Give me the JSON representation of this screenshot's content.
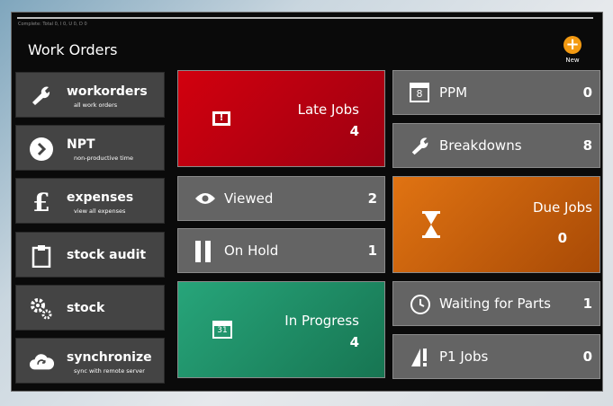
{
  "status_line": "Complete: Total 0, I 0, U 0, D 0",
  "app": {
    "title": "Work Orders",
    "new_label": "New"
  },
  "sidebar": {
    "items": [
      {
        "label": "workorders",
        "sub": "all work orders",
        "icon": "wrench-icon"
      },
      {
        "label": "NPT",
        "sub": "non-productive time",
        "icon": "arrow-right-circle-icon"
      },
      {
        "label": "expenses",
        "sub": "view all expenses",
        "icon": "pound-icon"
      },
      {
        "label": "stock audit",
        "sub": "",
        "icon": "clipboard-icon"
      },
      {
        "label": "stock",
        "sub": "",
        "icon": "gears-icon"
      },
      {
        "label": "synchronize",
        "sub": "sync with remote server",
        "icon": "cloud-sync-icon"
      }
    ]
  },
  "tiles": {
    "late_jobs": {
      "label": "Late Jobs",
      "count": "4",
      "color": "#b3000f"
    },
    "viewed": {
      "label": "Viewed",
      "count": "2"
    },
    "on_hold": {
      "label": "On Hold",
      "count": "1"
    },
    "in_progress": {
      "label": "In Progress",
      "count": "4",
      "color": "#1f8a66",
      "calendar_day": "31"
    },
    "ppm": {
      "label": "PPM",
      "count": "0",
      "calendar_day": "8"
    },
    "breakdowns": {
      "label": "Breakdowns",
      "count": "8"
    },
    "due_jobs": {
      "label": "Due Jobs",
      "count": "0",
      "color": "#c25d0c"
    },
    "waiting_for_parts": {
      "label": "Waiting for Parts",
      "count": "1"
    },
    "p1_jobs": {
      "label": "P1 Jobs",
      "count": "0"
    }
  }
}
